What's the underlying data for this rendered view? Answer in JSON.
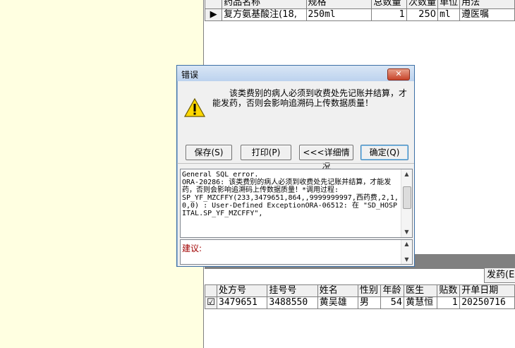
{
  "top_grid": {
    "columns": [
      "药品名称",
      "规格",
      "总数量",
      "次数量",
      "单位",
      "用法"
    ],
    "rows": [
      {
        "indicator": "▶",
        "name": "复方氨基酸注(18,",
        "spec": "250ml",
        "total": "1",
        "per": "250",
        "unit": "ml",
        "usage": "遵医嘱"
      }
    ]
  },
  "dialog": {
    "title": "错误",
    "message": "该类费别的病人必须到收费处先记账并结算，才能发药，否则会影响追溯码上传数据质量！",
    "buttons": {
      "save": "保存(S)",
      "print": "打印(P)",
      "detail": "<<<详细情况",
      "ok": "确定(Q)"
    },
    "detail_text": "General SQL error.\nORA-20286: 该类费别的病人必须到收费处先记账并结算，才能发药，否则会影响追溯码上传数据质量！*调用过程:\nSP_YF_MZCFFY(233,3479651,864,,9999999997,西药费,2,1,0,0) : User-Defined ExceptionORA-06512: 在 \"SD_HOSPITAL.SP_YF_MZCFFY\",",
    "suggest_label": "建议:"
  },
  "bottom": {
    "section_label": "发药(E",
    "columns": [
      "处方号",
      "挂号号",
      "姓名",
      "性别",
      "年龄",
      "医生",
      "贴数",
      "开单日期"
    ],
    "rows": [
      {
        "checked": "☑",
        "rx_no": "3479651",
        "reg_no": "3488550",
        "name": "黄吴雄",
        "gender": "男",
        "age": "54",
        "doctor": "黄慧恒",
        "doses": "1",
        "date": "20250716"
      }
    ]
  }
}
